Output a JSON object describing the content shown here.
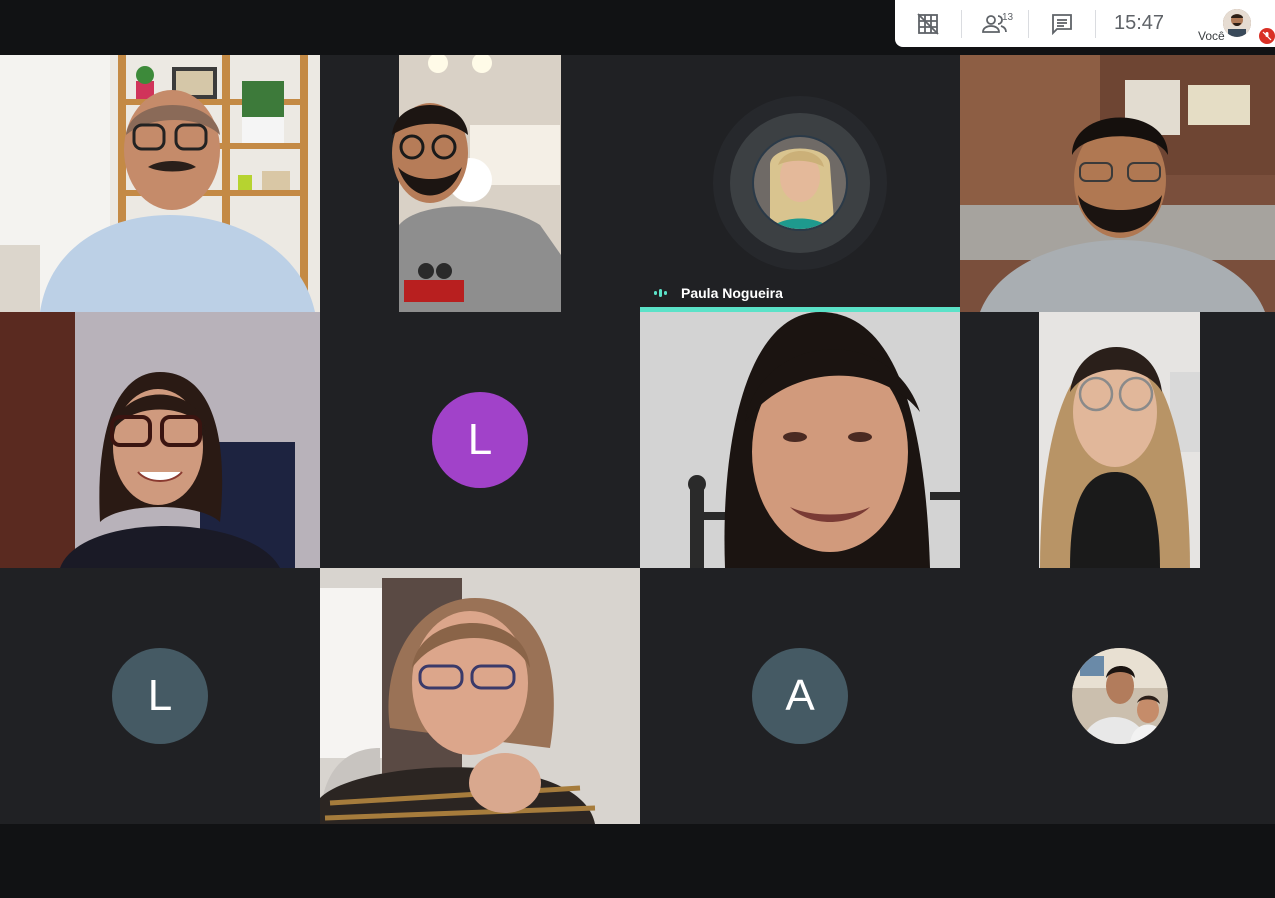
{
  "toolbar": {
    "participant_count": "13",
    "time": "15:47",
    "self_label": "Você"
  },
  "speaker": {
    "name": "Paula Nogueira"
  },
  "tiles": {
    "t6": {
      "initial": "L",
      "color": "#a142c9"
    },
    "t9": {
      "initial": "L",
      "color": "#455a64"
    },
    "t11": {
      "initial": "A",
      "color": "#455a64"
    }
  },
  "icons": {
    "layout": "grid-off-icon",
    "people": "people-icon",
    "chat": "chat-icon",
    "mic": "mic-off-icon"
  }
}
